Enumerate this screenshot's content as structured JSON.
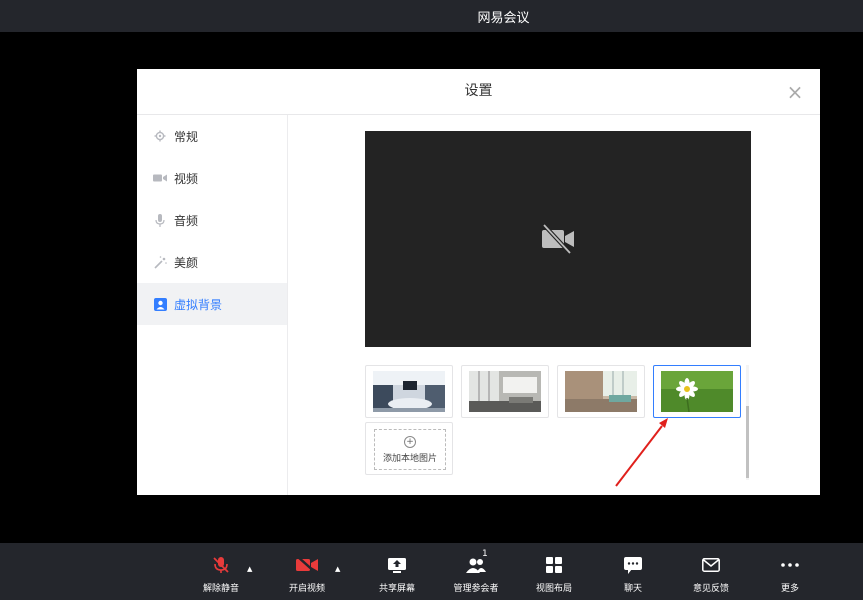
{
  "window": {
    "title": "网易会议"
  },
  "dialog": {
    "title": "设置",
    "close_glyph": "×",
    "nav": [
      {
        "label": "常规",
        "icon": "gear-icon"
      },
      {
        "label": "视频",
        "icon": "camera-icon"
      },
      {
        "label": "音频",
        "icon": "microphone-icon"
      },
      {
        "label": "美颜",
        "icon": "magic-wand-icon"
      },
      {
        "label": "虚拟背景",
        "icon": "portrait-icon",
        "active": true
      }
    ],
    "preview": {
      "state": "camera-off",
      "icon": "camera-off-icon"
    },
    "backgrounds": [
      {
        "name": "meeting-room"
      },
      {
        "name": "office-windows"
      },
      {
        "name": "office-lounge"
      },
      {
        "name": "daisy-on-grass",
        "selected": true
      }
    ],
    "add_local_image_label": "添加本地图片",
    "add_icon_glyph": "+"
  },
  "toolbar": {
    "unmute": {
      "label": "解除静音",
      "caret": "▲"
    },
    "start_video": {
      "label": "开启视频",
      "caret": "▲"
    },
    "share_screen": {
      "label": "共享屏幕"
    },
    "manage_participants": {
      "label": "管理参会者",
      "count": "1"
    },
    "view_layout": {
      "label": "视图布局"
    },
    "chat": {
      "label": "聊天"
    },
    "feedback": {
      "label": "意见反馈"
    },
    "more": {
      "label": "更多"
    }
  },
  "colors": {
    "accent": "#337eff",
    "danger": "#e83b3b",
    "toolbar_bg": "#24262c",
    "annotation_arrow": "#e0201c"
  }
}
